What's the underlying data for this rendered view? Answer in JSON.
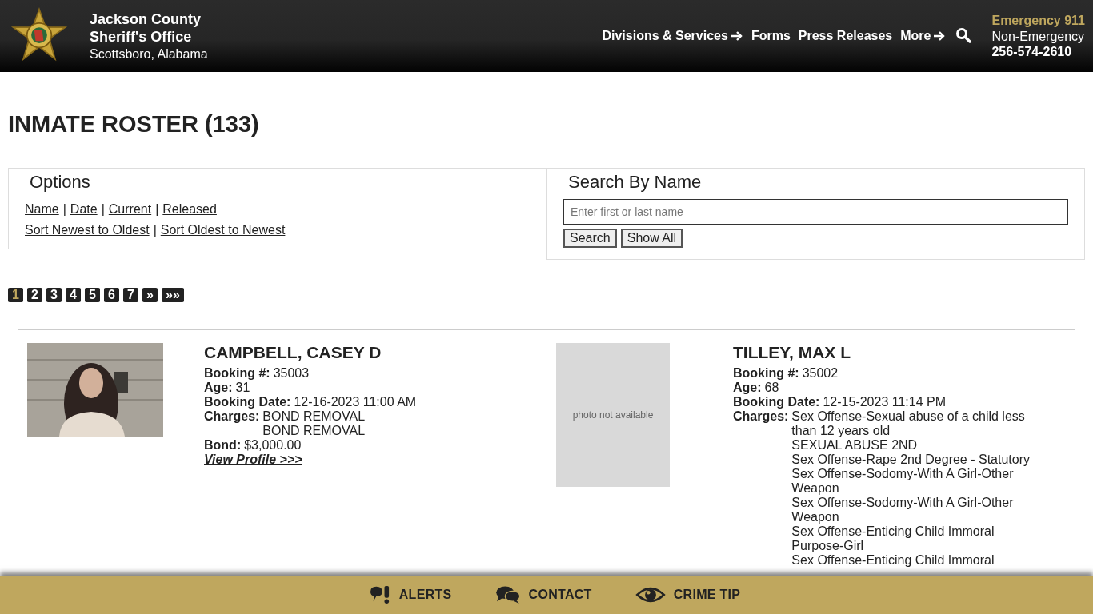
{
  "header": {
    "title_line1": "Jackson County",
    "title_line2": "Sheriff's Office",
    "subtitle": "Scottsboro, Alabama",
    "nav": [
      {
        "label": "Divisions & Services",
        "arrow": true
      },
      {
        "label": "Forms",
        "arrow": false
      },
      {
        "label": "Press Releases",
        "arrow": false
      },
      {
        "label": "More",
        "arrow": true
      }
    ],
    "emergency": "Emergency 911",
    "non_emergency": "Non-Emergency",
    "phone": "256-574-2610"
  },
  "page_title": "INMATE ROSTER (133)",
  "options": {
    "legend": "Options",
    "separator": "|",
    "sort_links": [
      "Name",
      "Date",
      "Current",
      "Released"
    ],
    "order_links": [
      "Sort Newest to Oldest",
      "Sort Oldest to Newest"
    ]
  },
  "search": {
    "legend": "Search By Name",
    "placeholder": "Enter first or last name",
    "buttons": [
      "Search",
      "Show All"
    ]
  },
  "pages": [
    {
      "label": "1",
      "selected": true
    },
    {
      "label": "2",
      "selected": false
    },
    {
      "label": "3",
      "selected": false
    },
    {
      "label": "4",
      "selected": false
    },
    {
      "label": "5",
      "selected": false
    },
    {
      "label": "6",
      "selected": false
    },
    {
      "label": "7",
      "selected": false
    },
    {
      "label": "»",
      "selected": false
    },
    {
      "label": "»»",
      "selected": false
    }
  ],
  "inmates": [
    {
      "name": "CAMPBELL, CASEY D",
      "fields": [
        {
          "label": "Booking #:",
          "values": [
            "35003"
          ]
        },
        {
          "label": "Age:",
          "values": [
            "31"
          ]
        },
        {
          "label": "Booking Date:",
          "values": [
            "12-16-2023 11:00 AM"
          ]
        },
        {
          "label": "Charges:",
          "values": [
            "BOND REMOVAL",
            "BOND REMOVAL"
          ]
        },
        {
          "label": "Bond:",
          "values": [
            "$3,000.00"
          ]
        }
      ],
      "profile_link": "View Profile >>>"
    },
    {
      "name": "TILLEY, MAX L",
      "photo": {
        "kind": "placeholder",
        "text": "photo not available"
      },
      "fields": [
        {
          "label": "Booking #:",
          "values": [
            "35002"
          ]
        },
        {
          "label": "Age:",
          "values": [
            "68"
          ]
        },
        {
          "label": "Booking Date:",
          "values": [
            "12-15-2023 11:14 PM"
          ]
        },
        {
          "label": "Charges:",
          "values": [
            "Sex Offense-Sexual abuse of a child less than 12 years old",
            "SEXUAL ABUSE 2ND",
            "Sex Offense-Rape 2nd Degree - Statutory",
            "Sex Offense-Sodomy-With A Girl-Other Weapon",
            "Sex Offense-Sodomy-With A Girl-Other Weapon",
            "Sex Offense-Enticing Child Immoral Purpose-Girl",
            "Sex Offense-Enticing Child Immoral"
          ]
        }
      ]
    }
  ],
  "footer": [
    {
      "kind": "alerts",
      "label": "ALERTS"
    },
    {
      "kind": "contact",
      "label": "CONTACT"
    },
    {
      "kind": "tip",
      "label": "CRIME TIP"
    }
  ]
}
